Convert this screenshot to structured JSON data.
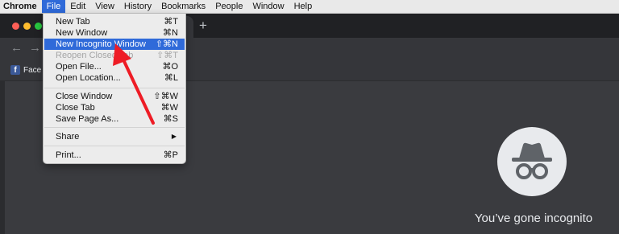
{
  "menubar": {
    "items": [
      "Chrome",
      "File",
      "Edit",
      "View",
      "History",
      "Bookmarks",
      "People",
      "Window",
      "Help"
    ],
    "active": "File"
  },
  "file_menu": {
    "items": [
      {
        "label": "New Tab",
        "shortcut": "⌘T",
        "state": "normal"
      },
      {
        "label": "New Window",
        "shortcut": "⌘N",
        "state": "normal"
      },
      {
        "label": "New Incognito Window",
        "shortcut": "⇧⌘N",
        "state": "highlighted"
      },
      {
        "label": "Reopen Closed Tab",
        "shortcut": "⇧⌘T",
        "state": "disabled"
      },
      {
        "label": "Open File...",
        "shortcut": "⌘O",
        "state": "normal"
      },
      {
        "label": "Open Location...",
        "shortcut": "⌘L",
        "state": "normal"
      },
      {
        "label": "Close Window",
        "shortcut": "⇧⌘W",
        "state": "normal"
      },
      {
        "label": "Close Tab",
        "shortcut": "⌘W",
        "state": "normal"
      },
      {
        "label": "Save Page As...",
        "shortcut": "⌘S",
        "state": "normal"
      },
      {
        "label": "Share",
        "shortcut": "▶",
        "state": "submenu"
      },
      {
        "label": "Print...",
        "shortcut": "⌘P",
        "state": "normal"
      }
    ]
  },
  "bookmarks_bar": {
    "item_label": "Face",
    "item_icon": "facebook-icon"
  },
  "incognito": {
    "message": "You’ve gone incognito",
    "icon": "incognito-icon"
  },
  "tabstrip": {
    "new_tab_symbol": "+"
  },
  "toolbar": {
    "back_symbol": "←",
    "forward_symbol": "→"
  },
  "colors": {
    "menu_highlight": "#2f6ad9",
    "annotation_arrow": "#ee1c25",
    "window_bg": "#3a3b3f"
  }
}
